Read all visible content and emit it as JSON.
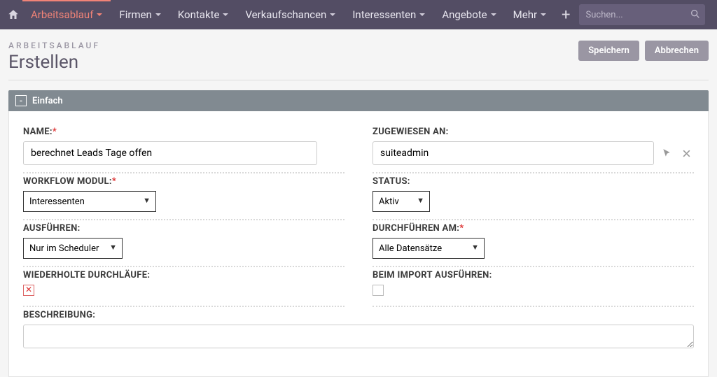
{
  "nav": {
    "items": [
      {
        "label": "Arbeitsablauf",
        "active": true
      },
      {
        "label": "Firmen"
      },
      {
        "label": "Kontakte"
      },
      {
        "label": "Verkaufschancen"
      },
      {
        "label": "Interessenten"
      },
      {
        "label": "Angebote"
      },
      {
        "label": "Mehr"
      }
    ],
    "search_placeholder": "Suchen..."
  },
  "header": {
    "breadcrumb": "ARBEITSABLAUF",
    "title": "Erstellen",
    "save_label": "Speichern",
    "cancel_label": "Abbrechen"
  },
  "panel": {
    "title": "Einfach",
    "collapse_glyph": "-"
  },
  "form": {
    "name": {
      "label": "NAME:",
      "value": "berechnet Leads Tage offen",
      "required": true
    },
    "assigned_to": {
      "label": "ZUGEWIESEN AN:",
      "value": "suiteadmin"
    },
    "workflow_module": {
      "label": "WORKFLOW MODUL:",
      "value": "Interessenten",
      "required": true
    },
    "status": {
      "label": "STATUS:",
      "value": "Aktiv"
    },
    "run": {
      "label": "AUSFÜHREN:",
      "value": "Nur im Scheduler"
    },
    "run_on": {
      "label": "DURCHFÜHREN AM:",
      "value": "Alle Datensätze",
      "required": true
    },
    "repeated_runs": {
      "label": "WIEDERHOLTE DURCHLÄUFE:",
      "checked": false
    },
    "run_on_import": {
      "label": "BEIM IMPORT AUSFÜHREN:",
      "checked": false
    },
    "description": {
      "label": "BESCHREIBUNG:",
      "value": ""
    }
  }
}
